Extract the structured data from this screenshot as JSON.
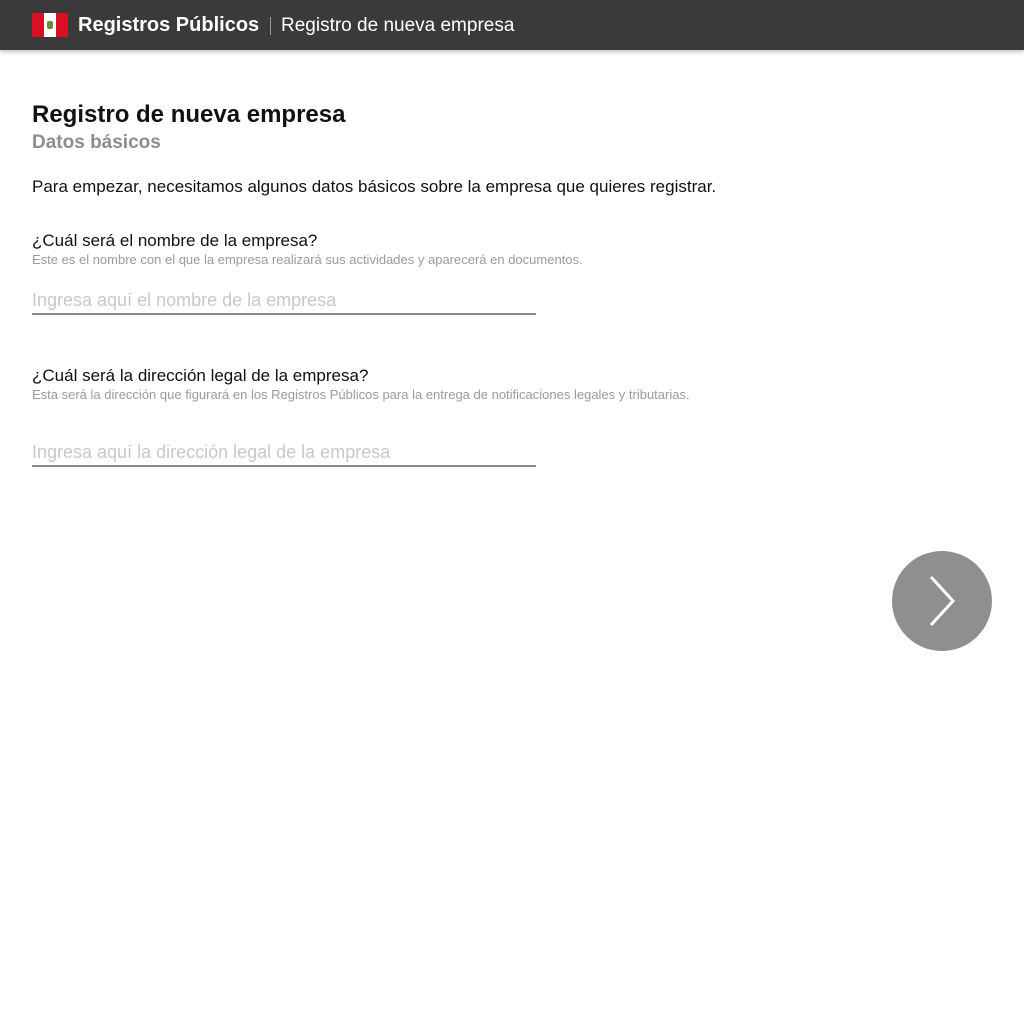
{
  "header": {
    "flag_icon": "peru-flag-icon",
    "brand": "Registros Públicos",
    "breadcrumb": "Registro de nueva empresa",
    "background_color": "#3a3a3a"
  },
  "main": {
    "title": "Registro de nueva empresa",
    "subtitle": "Datos básicos",
    "intro": "Para empezar, necesitamos algunos datos básicos sobre la empresa que quieres registrar.",
    "questions": [
      {
        "label": "¿Cuál será el nombre de la empresa?",
        "help": "Este es el nombre con el que la empresa realizará sus actividades y aparecerá en documentos.",
        "value": "",
        "placeholder": "Ingresa aquí el nombre de la empresa"
      },
      {
        "label": "¿Cuál será la dirección legal de la empresa?",
        "help": "Esta será la dirección que figurará en los Registros Públicos para la entrega de notificaciones legales y tributarias.",
        "value": "",
        "placeholder": "Ingresa aquí la dirección legal de la empresa"
      }
    ],
    "next_button": {
      "icon": "chevron-right-icon",
      "color": "#8f8f8f"
    }
  }
}
